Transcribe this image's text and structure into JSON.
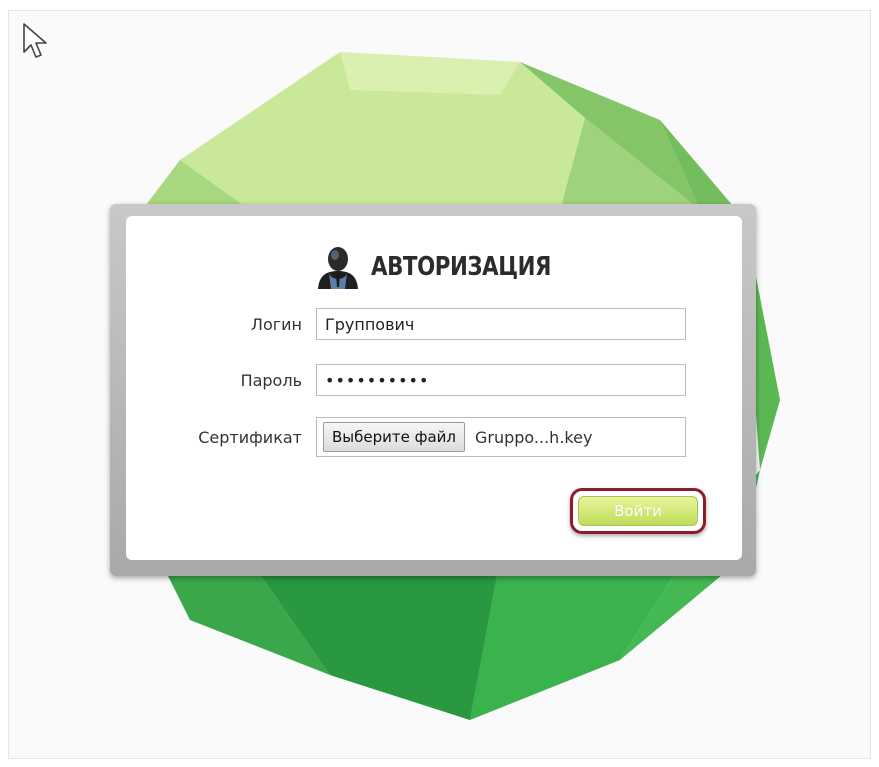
{
  "dialog": {
    "title": "АВТОРИЗАЦИЯ",
    "user_icon": "user-silhouette-icon"
  },
  "form": {
    "login_label": "Логин",
    "login_value": "Группович",
    "password_label": "Пароль",
    "password_value": "••••••••••",
    "certificate_label": "Сертификат",
    "file_button_label": "Выберите файл",
    "file_name": "Gruppo...h.key"
  },
  "actions": {
    "submit_label": "Войти"
  },
  "colors": {
    "submit_ring": "#8a1f2a",
    "submit_fill": "#cfe57a",
    "gem_green": "#4db24f"
  }
}
